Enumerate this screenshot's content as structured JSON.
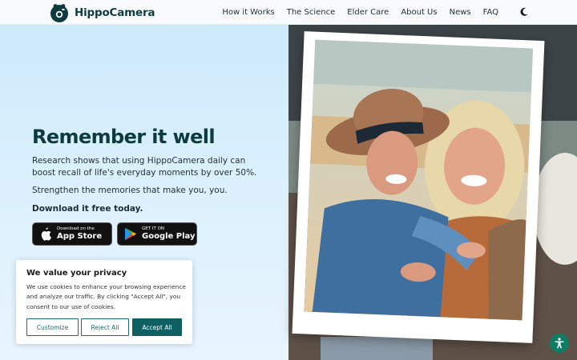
{
  "brand": {
    "name": "HippoCamera"
  },
  "nav": {
    "items": [
      "How it Works",
      "The Science",
      "Elder Care",
      "About Us",
      "News",
      "FAQ"
    ]
  },
  "hero": {
    "headline_part1": "Remember",
    "headline_part2": " it well",
    "para1": "Research shows that using HippoCamera daily can boost recall of life's everyday moments by over 50%.",
    "para2": "Strengthen the memories that make you, you.",
    "para3": "Download it free today.",
    "apple": {
      "small": "Download on the",
      "big": "App Store"
    },
    "google": {
      "small": "GET IT ON",
      "big": "Google Play"
    }
  },
  "cookie": {
    "title": "We value your privacy",
    "text": "We use cookies to enhance your browsing experience and analyze our traffic. By clicking \"Accept All\", you consent to our use of cookies.",
    "customize": "Customize",
    "reject": "Reject All",
    "accept": "Accept All"
  },
  "colors": {
    "brand_dark": "#0d3b3e",
    "accent": "#0f5f63",
    "a11y": "#0f7d63"
  },
  "icons": [
    "hippo-logo-icon",
    "moon-icon",
    "apple-icon",
    "google-play-icon",
    "accessibility-icon"
  ]
}
